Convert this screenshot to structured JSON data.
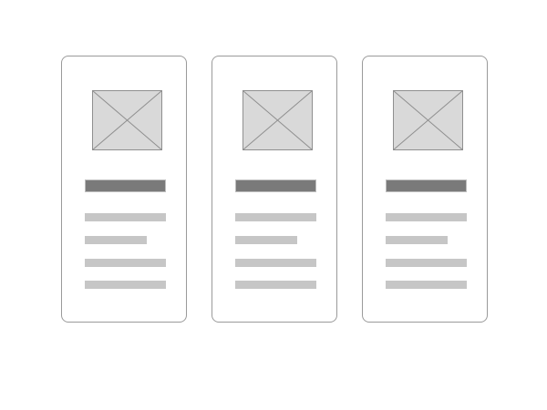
{
  "colors": {
    "card_border": "#9a9a9a",
    "image_fill": "#d9d9d9",
    "image_stroke": "#8f8f8f",
    "title_bar": "#7a7a7a",
    "text_line": "#c6c6c6"
  },
  "cards": [
    {
      "has_image": true,
      "lines": 4
    },
    {
      "has_image": true,
      "lines": 4
    },
    {
      "has_image": true,
      "lines": 4
    }
  ]
}
